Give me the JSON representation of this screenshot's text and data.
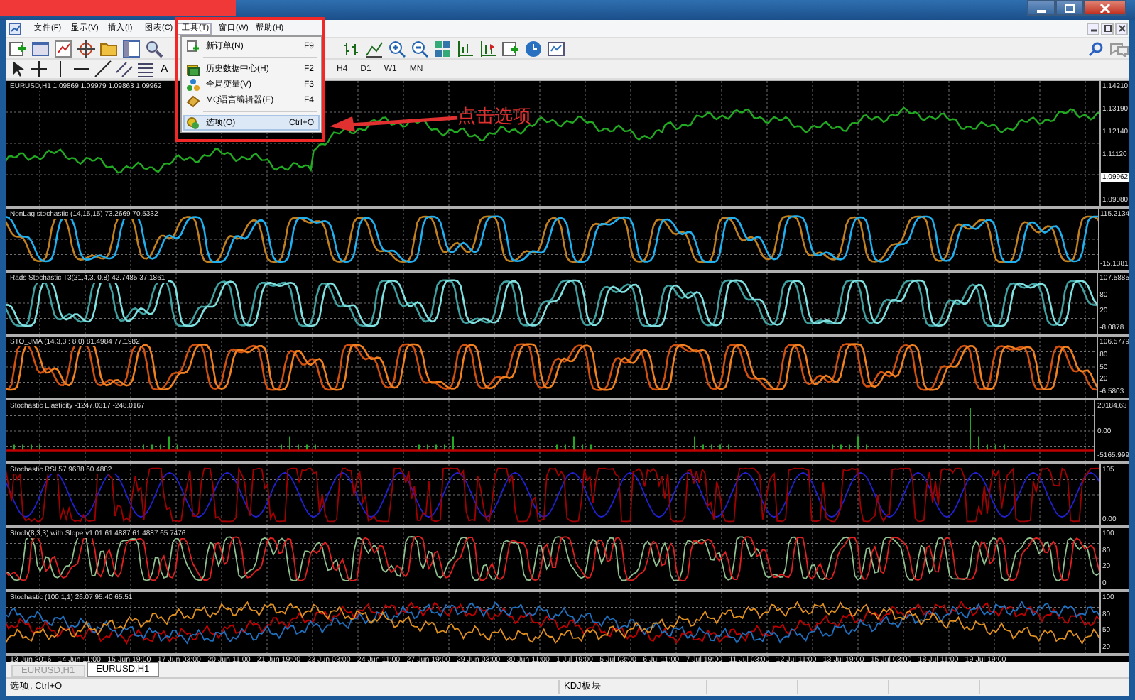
{
  "menu_bar": [
    {
      "label": "文件(F)",
      "selected": false
    },
    {
      "label": "显示(V)",
      "selected": false
    },
    {
      "label": "插入(I)",
      "selected": false
    },
    {
      "label": "图表(C)",
      "selected": false
    },
    {
      "label": "工具(T)",
      "selected": true
    },
    {
      "label": "窗口(W)",
      "selected": false
    },
    {
      "label": "帮助(H)",
      "selected": false
    }
  ],
  "dropdown": [
    {
      "kind": "item",
      "label": "新订单(N)",
      "shortcut": "F9",
      "selected": false
    },
    {
      "kind": "separator"
    },
    {
      "kind": "item",
      "label": "历史数据中心(H)",
      "shortcut": "F2",
      "selected": false
    },
    {
      "kind": "item",
      "label": "全局变量(V)",
      "shortcut": "F3",
      "selected": false
    },
    {
      "kind": "item",
      "label": "MQ语言编辑器(E)",
      "shortcut": "F4",
      "selected": false
    },
    {
      "kind": "separator"
    },
    {
      "kind": "item",
      "label": "选项(O)",
      "shortcut": "Ctrl+O",
      "selected": true
    }
  ],
  "annotation": "点击选项",
  "text_tool": "A",
  "timeframes": [
    "H4",
    "D1",
    "W1",
    "MN"
  ],
  "panes": [
    {
      "kind": "price",
      "title": "EURUSD,H1 1.09869 1.09979 1.09863 1.09962",
      "series": [
        {
          "color": "#22aa22"
        }
      ],
      "axis_labels": [
        {
          "text": "1.14210",
          "highlighted": false
        },
        {
          "text": "1.13190",
          "highlighted": false
        },
        {
          "text": "1.12140",
          "highlighted": false
        },
        {
          "text": "1.11120",
          "highlighted": false
        },
        {
          "text": "1.09962",
          "highlighted": true
        },
        {
          "text": "1.09080",
          "highlighted": false
        }
      ]
    },
    {
      "kind": "smooth",
      "title": "NonLag stochastic (14,15,15) 73.2669 70.5332",
      "series": [
        {
          "color": "#c08020"
        },
        {
          "color": "#20b0f0"
        }
      ],
      "axis_labels": [
        "115.2134",
        "-15.1381"
      ]
    },
    {
      "kind": "smooth",
      "title": "Rads Stochastic T3(21,4,3, 0.8) 42.7485 37.1861",
      "series": [
        {
          "color": "#40a0a0"
        },
        {
          "color": "#80e0e0"
        }
      ],
      "axis_labels": [
        "107.5885",
        "80",
        "20",
        "-8.0878"
      ]
    },
    {
      "kind": "smooth",
      "title": "STO_JMA (14,3,3 : 8.0) 81.4984 77.1982",
      "series": [
        {
          "color": "#d05010"
        },
        {
          "color": "#f08020"
        }
      ],
      "axis_labels": [
        "106.5779",
        "80",
        "50",
        "20",
        "-6.5803"
      ]
    },
    {
      "kind": "histogram",
      "title": "Stochastic Elasticity -1247.0317 -248.0167",
      "series": [
        {
          "color": "#22aa22"
        },
        {
          "color": "#c00000"
        }
      ],
      "axis_labels": [
        "20184.63",
        "0.00",
        "-5165.999"
      ]
    },
    {
      "kind": "noisy",
      "title": "Stochastic RSI 57.9688 60.4882",
      "series": [
        {
          "color": "#2020d0"
        },
        {
          "color": "#a00000"
        }
      ],
      "axis_labels": [
        "105",
        "0.00"
      ]
    },
    {
      "kind": "dotted",
      "title": "Stoch(8,3,3) with Slope v1.01 61.4887 61.4887 65.7476",
      "series": [
        {
          "color": "#90c090"
        },
        {
          "color": "#e02020"
        }
      ],
      "axis_labels": [
        "100",
        "80",
        "20",
        "0"
      ]
    },
    {
      "kind": "multi",
      "title": "Stochastic (100,1,1) 26.07 95.40 65.51",
      "series": [
        {
          "color": "#c00000"
        },
        {
          "color": "#2070c0"
        },
        {
          "color": "#e09020"
        }
      ],
      "axis_labels": [
        "100",
        "80",
        "50",
        "20"
      ]
    }
  ],
  "time_axis": [
    "13 Jun 2016",
    "14 Jun 11:00",
    "15 Jun 19:00",
    "17 Jun 03:00",
    "20 Jun 11:00",
    "21 Jun 19:00",
    "23 Jun 03:00",
    "24 Jun 11:00",
    "27 Jun 19:00",
    "29 Jun 03:00",
    "30 Jun 11:00",
    "1 Jul 19:00",
    "5 Jul 03:00",
    "6 Jul 11:00",
    "7 Jul 19:00",
    "11 Jul 03:00",
    "12 Jul 11:00",
    "13 Jul 19:00",
    "15 Jul 03:00",
    "18 Jul 11:00",
    "19 Jul 19:00"
  ],
  "tabs": [
    {
      "label": "EURUSD,H1",
      "selected": false
    },
    {
      "label": "EURUSD,H1",
      "selected": true
    }
  ],
  "status_bar": [
    "选项, Ctrl+O",
    "KDJ板块"
  ]
}
